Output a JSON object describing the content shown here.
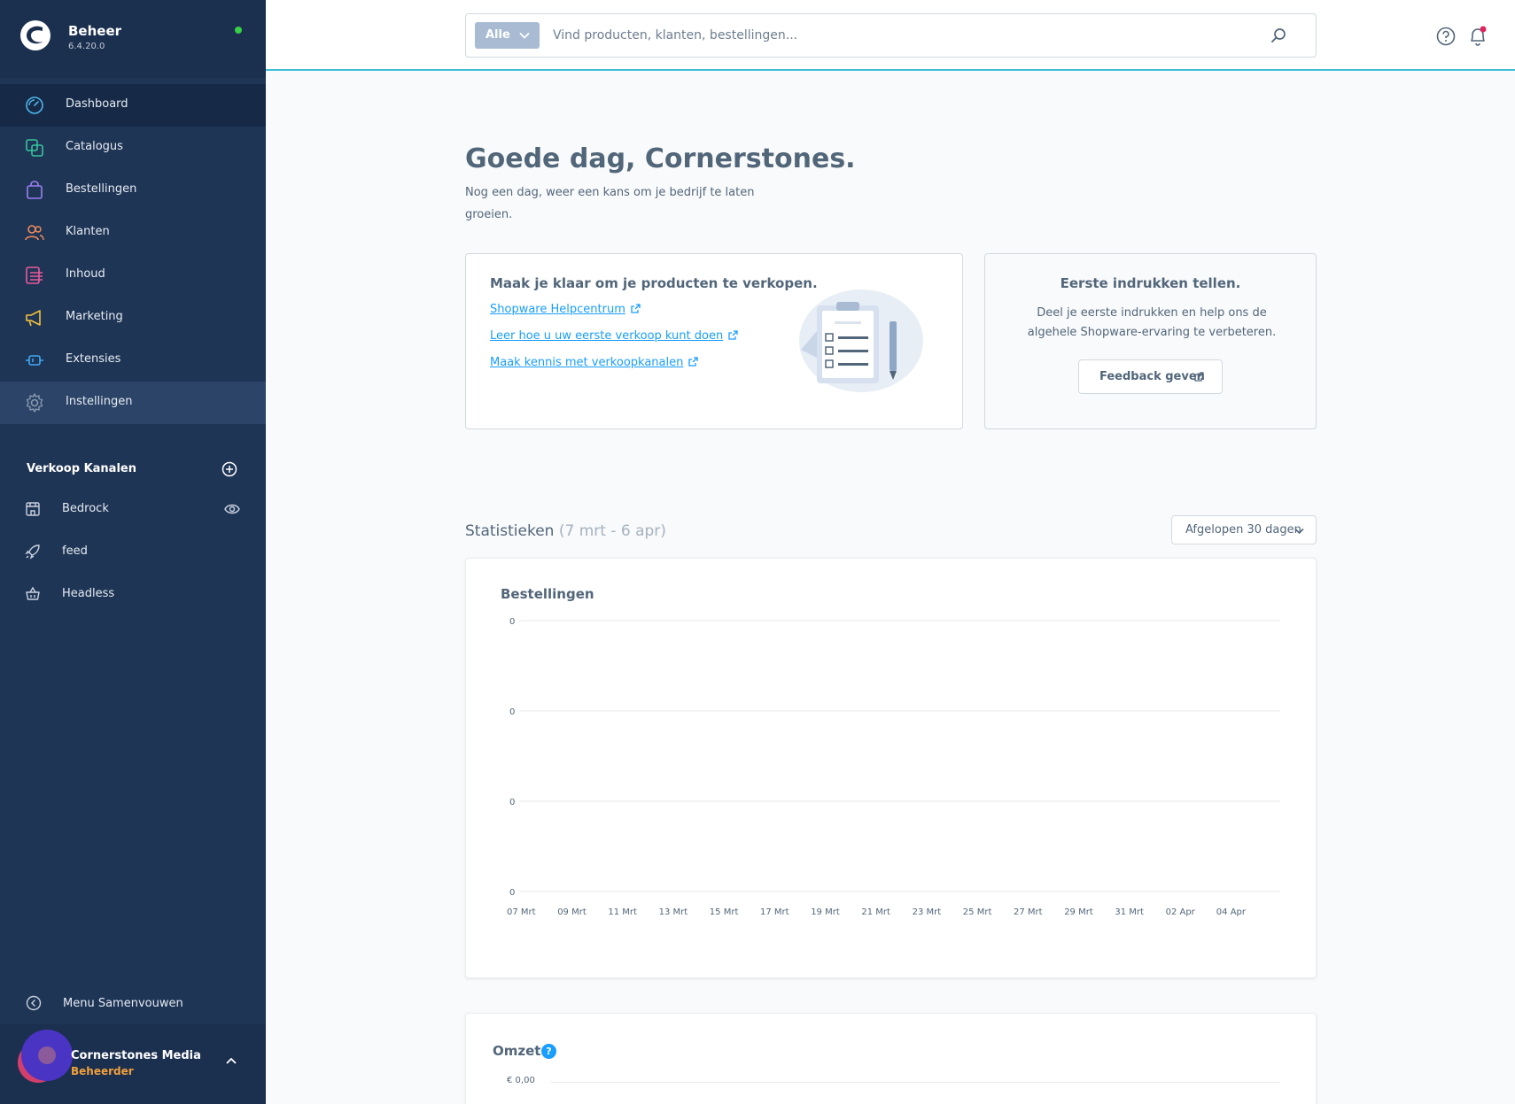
{
  "brand": {
    "title": "Beheer",
    "version": "6.4.20.0",
    "status_color": "#37d046"
  },
  "nav": [
    {
      "label": "Dashboard",
      "icon": "dashboard-icon",
      "color": "#4fb4e8"
    },
    {
      "label": "Catalogus",
      "icon": "catalog-icon",
      "color": "#36c49a"
    },
    {
      "label": "Bestellingen",
      "icon": "shopping-bag-icon",
      "color": "#9a7ff0"
    },
    {
      "label": "Klanten",
      "icon": "users-icon",
      "color": "#f28b5a"
    },
    {
      "label": "Inhoud",
      "icon": "content-icon",
      "color": "#e85a9a"
    },
    {
      "label": "Marketing",
      "icon": "megaphone-icon",
      "color": "#f2c23b"
    },
    {
      "label": "Extensies",
      "icon": "plug-icon",
      "color": "#3ea8f0"
    },
    {
      "label": "Instellingen",
      "icon": "gear-icon",
      "color": "#8a9ab0"
    }
  ],
  "sales_channels": {
    "title": "Verkoop Kanalen",
    "items": [
      {
        "label": "Bedrock",
        "icon": "storefront-icon"
      },
      {
        "label": "feed",
        "icon": "rocket-icon"
      },
      {
        "label": "Headless",
        "icon": "basket-icon"
      }
    ]
  },
  "collapse_label": "Menu Samenvouwen",
  "user": {
    "name": "Cornerstones Media",
    "role": "Beheerder"
  },
  "search": {
    "type_label": "Alle",
    "placeholder": "Vind producten, klanten, bestellingen..."
  },
  "greeting": {
    "title": "Goede dag, Cornerstones.",
    "subtitle": "Nog een dag, weer een kans om je bedrijf te laten groeien."
  },
  "getting_started": {
    "title": "Maak je klaar om je producten te verkopen.",
    "links": [
      "Shopware Helpcentrum",
      "Leer hoe u uw eerste verkoop kunt doen",
      "Maak kennis met verkoopkanalen"
    ]
  },
  "feedback": {
    "title": "Eerste indrukken tellen.",
    "text": "Deel je eerste indrukken en help ons de algehele Shopware-ervaring te verbeteren.",
    "button": "Feedback geven"
  },
  "statistics": {
    "title": "Statistieken",
    "range": "(7 mrt - 6 apr)",
    "range_select": "Afgelopen 30 dagen"
  },
  "chart_data": [
    {
      "type": "line",
      "title": "Bestellingen",
      "x": [
        "07 Mrt",
        "09 Mrt",
        "11 Mrt",
        "13 Mrt",
        "15 Mrt",
        "17 Mrt",
        "19 Mrt",
        "21 Mrt",
        "23 Mrt",
        "25 Mrt",
        "27 Mrt",
        "29 Mrt",
        "31 Mrt",
        "02 Apr",
        "04 Apr"
      ],
      "y_ticks": [
        "0",
        "0",
        "0",
        "0"
      ],
      "series": [
        {
          "values": [
            0,
            0,
            0,
            0,
            0,
            0,
            0,
            0,
            0,
            0,
            0,
            0,
            0,
            0,
            0
          ]
        }
      ],
      "grid": true
    },
    {
      "type": "line",
      "title": "Omzet",
      "y_ticks": [
        "€ 0,00"
      ],
      "grid": true
    }
  ]
}
